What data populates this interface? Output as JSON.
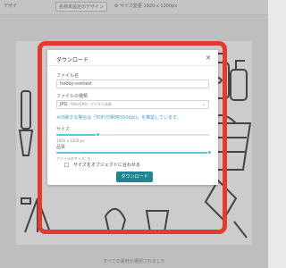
{
  "toolbar": {
    "left_text": "デザイ",
    "rename_button": "名称未設定のデザイン",
    "size_label": "サイズ変更",
    "size_value": "1920 x 1200px"
  },
  "footer_hint": "すべての素材が選択されました",
  "dialog": {
    "title": "ダウンロード",
    "close_icon": "close-icon",
    "filename_label": "ファイル名",
    "filename_value": "hobby-contest",
    "filetype_label": "ファイルの種類",
    "filetype_value": "JPG",
    "filetype_sub": "Web/SNS・デジタル画像",
    "print_note": "※印刷する場合は「PDF(印刷用350dpi)」を推奨しています。",
    "size_label": "サイズ",
    "size_slider": 0.27,
    "size_readout": "1920 x 1200 px",
    "quality_label": "品質",
    "quality_slider": 1.0,
    "filesize_text": "ファイルのサイズ: 大",
    "fit_checkbox_label": "サイズをオブジェクトに合わせる",
    "fit_checked": false,
    "download_button": "ダウンロード"
  },
  "colors": {
    "highlight_frame": "#e43b2c",
    "primary_button": "#1e8591",
    "link_note": "#3aa0d8",
    "slider": "#64c0e8"
  }
}
